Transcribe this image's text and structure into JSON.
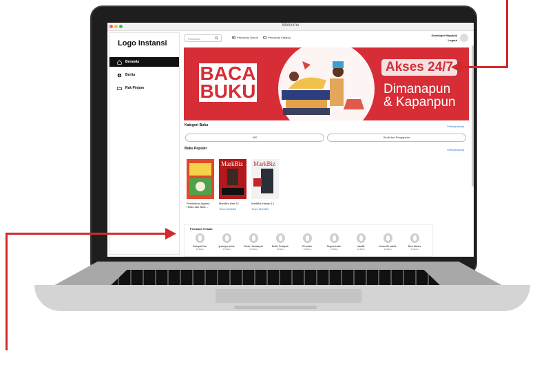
{
  "window": {
    "title": "Welcome"
  },
  "sidebar": {
    "logo": "Logo Instansi",
    "items": [
      {
        "label": "Beranda",
        "icon": "home-icon",
        "active": true
      },
      {
        "label": "Berita",
        "icon": "globe-icon",
        "active": false
      },
      {
        "label": "Rak Pinjam",
        "icon": "folder-icon",
        "active": false
      }
    ]
  },
  "topbar": {
    "search_placeholder": "Pencarian",
    "radio_options": [
      {
        "label": "Pencarian Umum",
        "checked": true
      },
      {
        "label": "Pencarian Katalog",
        "checked": false
      }
    ],
    "user_name": "Developer Republik",
    "logout_label": "Logout"
  },
  "banner": {
    "headline_line1": "BACA",
    "headline_line2": "BUKU",
    "badge": "Akses 24/7",
    "tagline_line1": "Dimanapun",
    "tagline_line2": "& Kapanpun",
    "colors": {
      "bg": "#d72d36",
      "white": "#ffffff"
    }
  },
  "categories": {
    "title": "Kategori Buku",
    "see_all": "Selengkapnya",
    "items": [
      "000",
      "Studi dan Pengajaran"
    ]
  },
  "popular": {
    "title": "Buku Populer",
    "see_all": "Selengkapnya",
    "books": [
      {
        "title": "Pendidikan Agama Hindu dan Budi...",
        "author": "",
        "cover_color": "#e04a2a"
      },
      {
        "title": "MarkBiz-Hari-12",
        "author": "Team MarkBiz",
        "cover_color": "#b3191c",
        "cover_text": "MarkBiz"
      },
      {
        "title": "MarkBiz-Hasan-12",
        "author": "Team MarkBiz",
        "cover_color": "#f2f2f2",
        "cover_text": "MarkBiz"
      }
    ]
  },
  "readers": {
    "title": "Pembaca Terbaik",
    "items": [
      {
        "name": "Dwisyah Dwi",
        "count": "18 Buku"
      },
      {
        "name": "ghamiya adma",
        "count": "15 Buku"
      },
      {
        "name": "Rinah Hamidayah",
        "count": "14 Buku"
      },
      {
        "name": "Budhi Pradipah",
        "count": "14 Buku"
      },
      {
        "name": "ZH adam",
        "count": "13 Buku"
      },
      {
        "name": "Regina Indah",
        "count": "12 Buku"
      },
      {
        "name": "rasa68",
        "count": "12 Buku"
      },
      {
        "name": "Andra Sri adelia",
        "count": "12 Buku"
      },
      {
        "name": "Bina Mahes",
        "count": "11 Buku"
      }
    ]
  },
  "accent": {
    "callout": "#d12a2a",
    "link": "#2e7bd6"
  }
}
